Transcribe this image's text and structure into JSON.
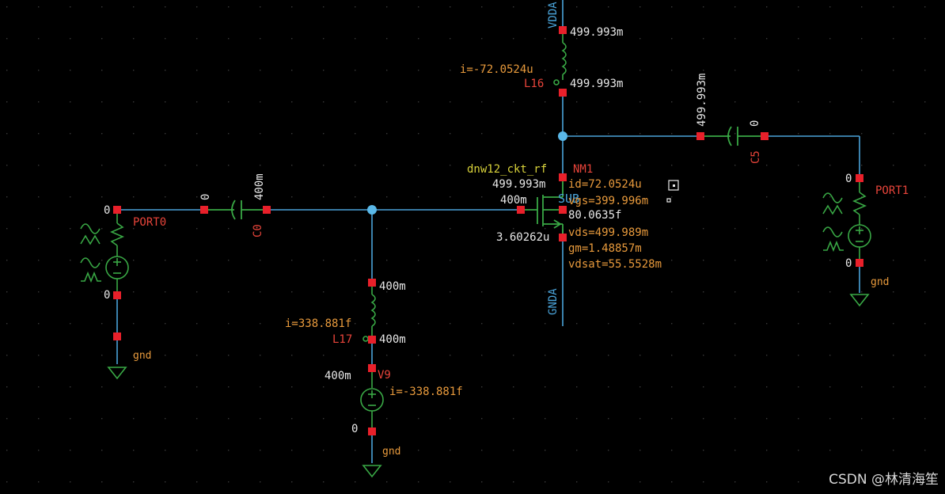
{
  "colors": {
    "background": "#000000",
    "grid": "#3a3a3a",
    "wire": "#4aa3d9",
    "node": "#e8202a",
    "junction": "#5ab8e8",
    "component": "#39a845",
    "value_text": "#e8e8e8",
    "annotation_text": "#e89a3c",
    "instance_text": "#e8443a",
    "model_text": "#d8d23a",
    "pin_text": "#4aa3d9",
    "watermark": "#d8d8d8"
  },
  "nets": {
    "vdd": "VDDA",
    "gnd_a": "GNDA",
    "sub": "SUB",
    "gnd": "gnd"
  },
  "components": {
    "nm1": {
      "instance": "NM1",
      "model": "dnw12_ckt_rf",
      "drain_v": "499.993m",
      "gate_v": "400m",
      "source_v": "3.60262u",
      "bulk_v": "80.0635f",
      "id": "id=72.0524u",
      "vgs": "vgs=399.996m",
      "vds": "vds=499.989m",
      "gm": "gm=1.48857m",
      "vdsat": "vdsat=55.5528m"
    },
    "l16": {
      "instance": "L16",
      "current": "i=-72.0524u",
      "top_v": "499.993m",
      "bot_v": "499.993m"
    },
    "l17": {
      "instance": "L17",
      "current": "i=338.881f",
      "top_v": "400m",
      "bot_v": "400m"
    },
    "v9": {
      "instance": "V9",
      "current": "i=-338.881f",
      "top_v": "400m",
      "bot_v": "0"
    },
    "c0": {
      "instance": "C0",
      "left_v": "0",
      "right_v": "400m"
    },
    "c5": {
      "instance": "C5",
      "left_v": "499.993m",
      "right_v": "0"
    },
    "port0": {
      "instance": "PORT0",
      "top_v": "0",
      "bot_v": "0"
    },
    "port1": {
      "instance": "PORT1",
      "top_v": "0",
      "bot_v": "0"
    }
  },
  "watermark": "CSDN @林清海笙"
}
